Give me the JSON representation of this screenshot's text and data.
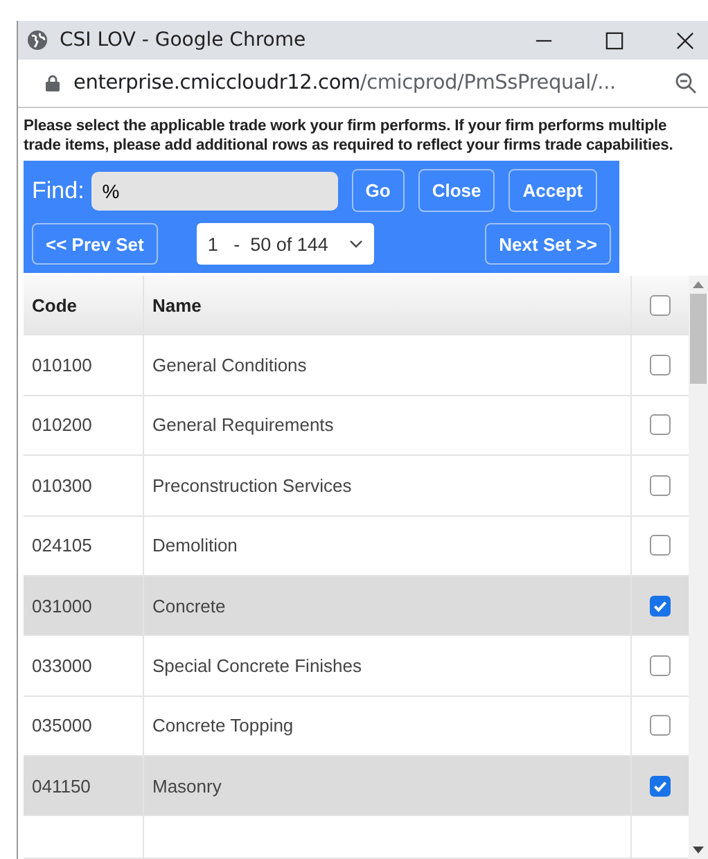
{
  "window": {
    "title": "CSI LOV - Google Chrome"
  },
  "address_bar": {
    "domain": "enterprise.cmiccloudr12.com",
    "path": "/cmicprod/PmSsPrequal/..."
  },
  "instructions": "Please select the applicable trade work your firm performs. If your firm performs multiple trade items, please add additional rows as required to reflect your firms trade capabilities.",
  "find": {
    "label": "Find:",
    "value": "%"
  },
  "buttons": [
    "Go",
    "Close",
    "Accept"
  ],
  "pager": {
    "prev": "<< Prev Set",
    "range": "1   -  50 of 144",
    "next": "Next Set >>"
  },
  "table": {
    "columns": [
      "Code",
      "Name"
    ],
    "header_checked": false,
    "rows": [
      {
        "code": "010100",
        "name": "General Conditions",
        "checked": false
      },
      {
        "code": "010200",
        "name": "General Requirements",
        "checked": false
      },
      {
        "code": "010300",
        "name": "Preconstruction Services",
        "checked": false
      },
      {
        "code": "024105",
        "name": "Demolition",
        "checked": false
      },
      {
        "code": "031000",
        "name": "Concrete",
        "checked": true
      },
      {
        "code": "033000",
        "name": "Special Concrete Finishes",
        "checked": false
      },
      {
        "code": "035000",
        "name": "Concrete Topping",
        "checked": false
      },
      {
        "code": "041150",
        "name": "Masonry",
        "checked": true
      }
    ]
  }
}
